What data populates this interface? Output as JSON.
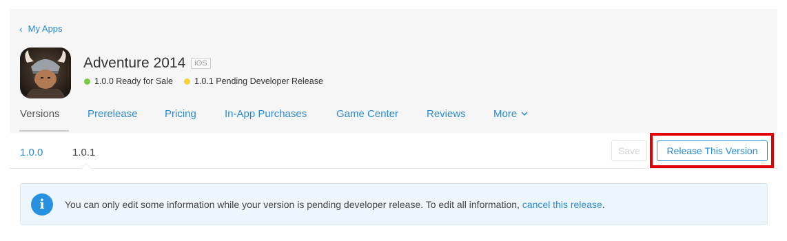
{
  "breadcrumb": {
    "back_label": "My Apps"
  },
  "app": {
    "title": "Adventure 2014",
    "platform": "iOS",
    "statuses": [
      {
        "label": "1.0.0 Ready for Sale",
        "color": "#7ac943"
      },
      {
        "label": "1.0.1 Pending Developer Release",
        "color": "#f2d43a"
      }
    ]
  },
  "tabs": {
    "versions": "Versions",
    "prerelease": "Prerelease",
    "pricing": "Pricing",
    "iap": "In-App Purchases",
    "game_center": "Game Center",
    "reviews": "Reviews",
    "more": "More"
  },
  "versions": {
    "v1": "1.0.0",
    "v2": "1.0.1",
    "selected": "1.0.1"
  },
  "actions": {
    "save": "Save",
    "release": "Release This Version"
  },
  "notice": {
    "text": "You can only edit some information while your version is pending developer release. To edit all information, ",
    "link": "cancel this release",
    "end": "."
  },
  "colors": {
    "accent": "#2a8bd6",
    "highlight": "#e00000"
  }
}
